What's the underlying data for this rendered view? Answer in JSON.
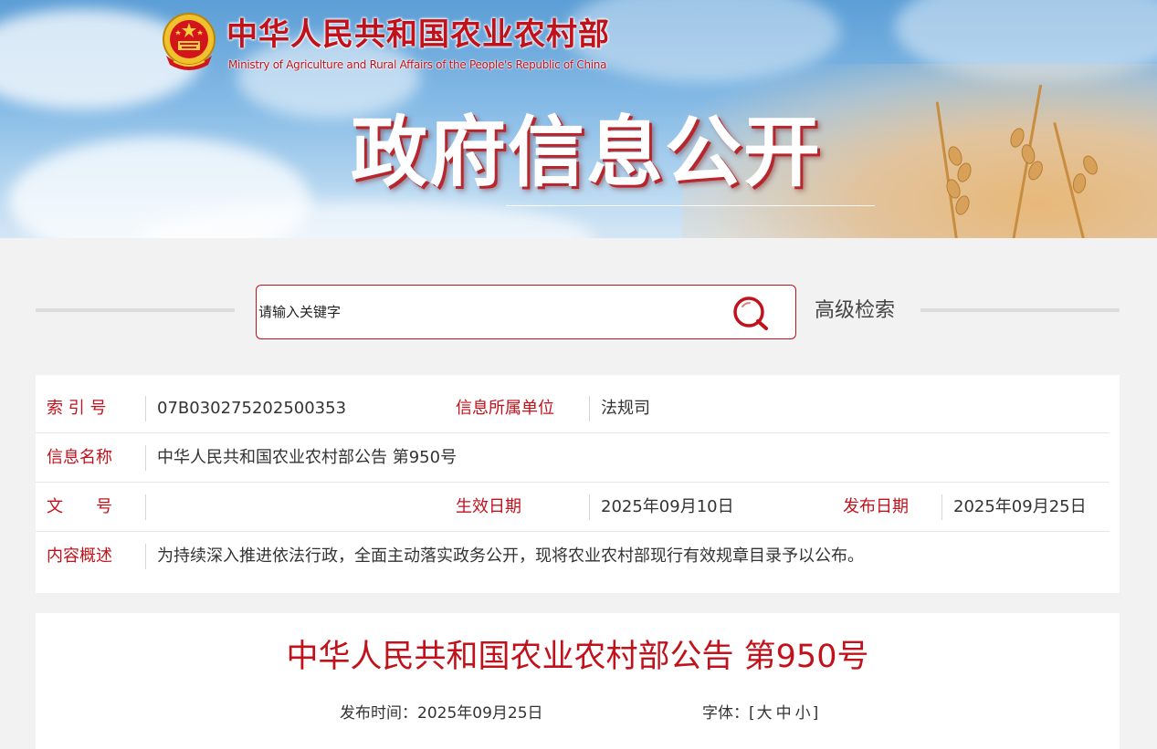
{
  "header": {
    "ministry_cn": "中华人民共和国农业农村部",
    "ministry_en": "Ministry of Agriculture and Rural Affairs of the People's Republic of China",
    "section_title": "政府信息公开",
    "emblem_icon": "national-emblem-icon"
  },
  "search": {
    "placeholder": "请输入关键字",
    "search_icon": "search-icon",
    "advanced_label": "高级检索"
  },
  "meta": {
    "index_label": "索 引 号",
    "index_value": "07B030275202500353",
    "unit_label": "信息所属单位",
    "unit_value": "法规司",
    "name_label": "信息名称",
    "name_value": "中华人民共和国农业农村部公告 第950号",
    "docno_label": "文　　号",
    "docno_value": "",
    "effective_label": "生效日期",
    "effective_value": "2025年09月10日",
    "publish_label": "发布日期",
    "publish_value": "2025年09月25日",
    "summary_label": "内容概述",
    "summary_value": "为持续深入推进依法行政，全面主动落实政务公开，现将农业农村部现行有效规章目录予以公布。"
  },
  "article": {
    "title": "中华人民共和国农业农村部公告 第950号",
    "publish_time": "发布时间：2025年09月25日",
    "font_label": "字体：[",
    "font_large": "大",
    "font_medium": "中",
    "font_small": "小",
    "font_close": "]"
  },
  "colors": {
    "accent": "#c1121c",
    "background": "#f2f2f2",
    "panel": "#ffffff"
  }
}
